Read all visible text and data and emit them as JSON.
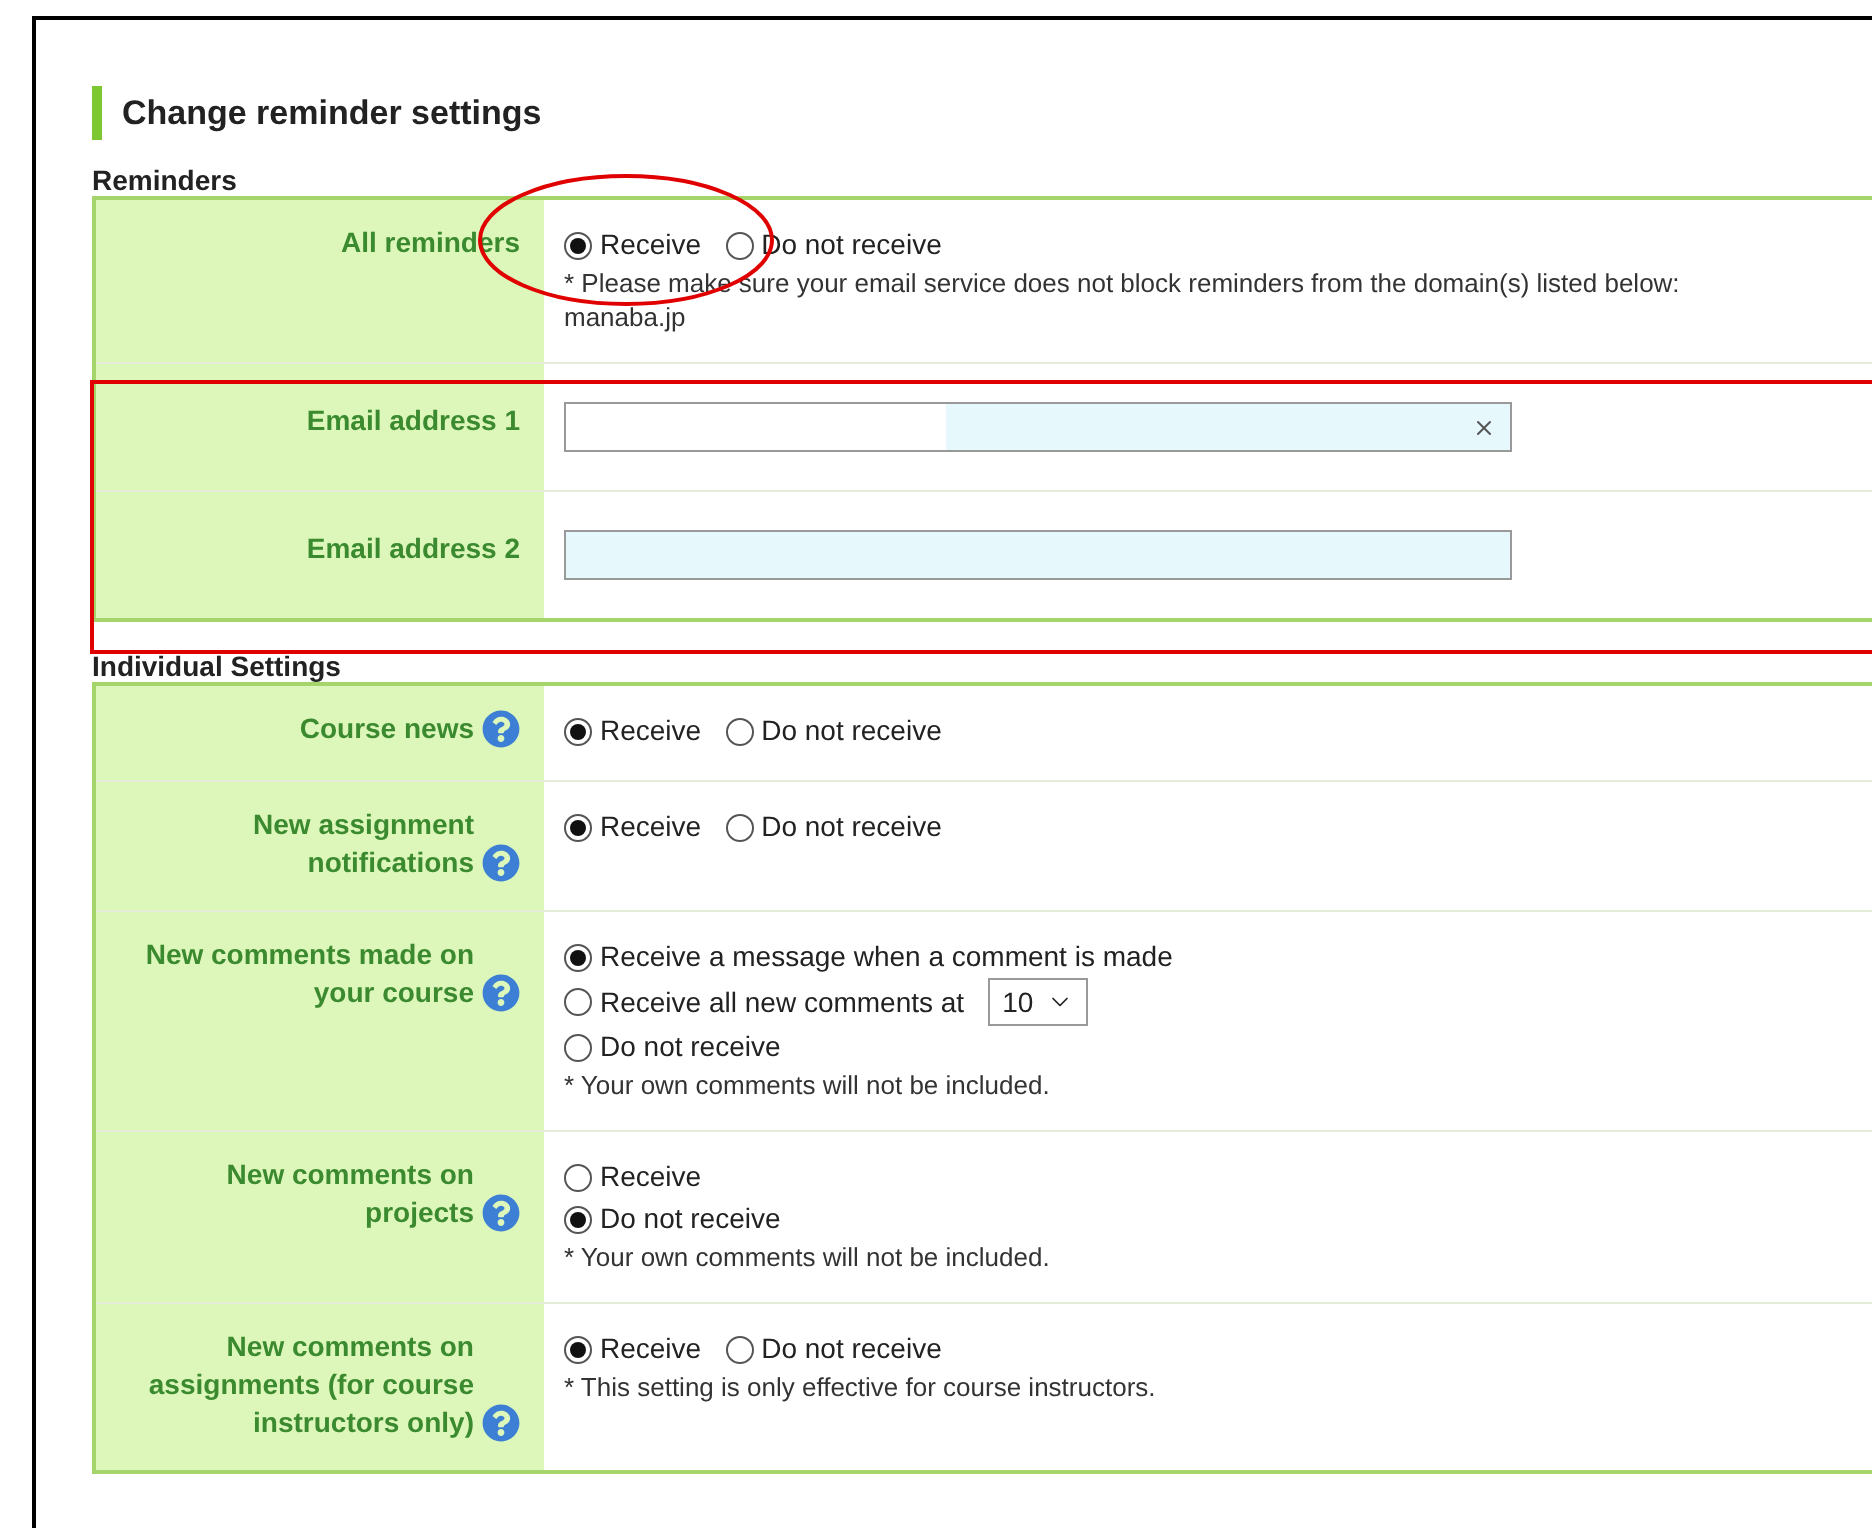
{
  "title": "Change reminder settings",
  "sections": [
    {
      "heading": "Reminders",
      "rows": [
        {
          "kind": "radio",
          "label": "All reminders",
          "help": false,
          "stacked": false,
          "options": [
            {
              "label": "Receive",
              "selected": true
            },
            {
              "label": "Do not receive",
              "selected": false
            }
          ],
          "notes": [
            "* Please make sure your email service does not block reminders from the domain(s) listed below:",
            "manaba.jp"
          ]
        },
        {
          "kind": "input",
          "label": "Email address 1",
          "help": false,
          "filled": true
        },
        {
          "kind": "input",
          "label": "Email address 2",
          "help": false,
          "filled": false
        }
      ]
    },
    {
      "heading": "Individual Settings",
      "rows": [
        {
          "kind": "radio",
          "label": "Course news",
          "help": true,
          "stacked": false,
          "options": [
            {
              "label": "Receive",
              "selected": true
            },
            {
              "label": "Do not receive",
              "selected": false
            }
          ]
        },
        {
          "kind": "radio",
          "label": "New assignment notifications",
          "help": true,
          "stacked": false,
          "options": [
            {
              "label": "Receive",
              "selected": true
            },
            {
              "label": "Do not receive",
              "selected": false
            }
          ]
        },
        {
          "kind": "radio",
          "label": "New comments made on your course",
          "help": true,
          "stacked": true,
          "options": [
            {
              "label": "Receive a message when a comment is made",
              "selected": true
            },
            {
              "label": "Receive all new comments at",
              "selected": false,
              "dropdown": "10"
            },
            {
              "label": "Do not receive",
              "selected": false
            }
          ],
          "notes": [
            "* Your own comments will not be included."
          ]
        },
        {
          "kind": "radio",
          "label": "New comments on projects",
          "help": true,
          "stacked": true,
          "options": [
            {
              "label": "Receive",
              "selected": false
            },
            {
              "label": "Do not receive",
              "selected": true
            }
          ],
          "notes": [
            "* Your own comments will not be included."
          ]
        },
        {
          "kind": "radio",
          "label": "New comments on assignments (for course instructors only)",
          "help": true,
          "stacked": false,
          "options": [
            {
              "label": "Receive",
              "selected": true
            },
            {
              "label": "Do not receive",
              "selected": false
            }
          ],
          "notes": [
            "* This setting is only effective for course instructors."
          ]
        }
      ]
    }
  ]
}
